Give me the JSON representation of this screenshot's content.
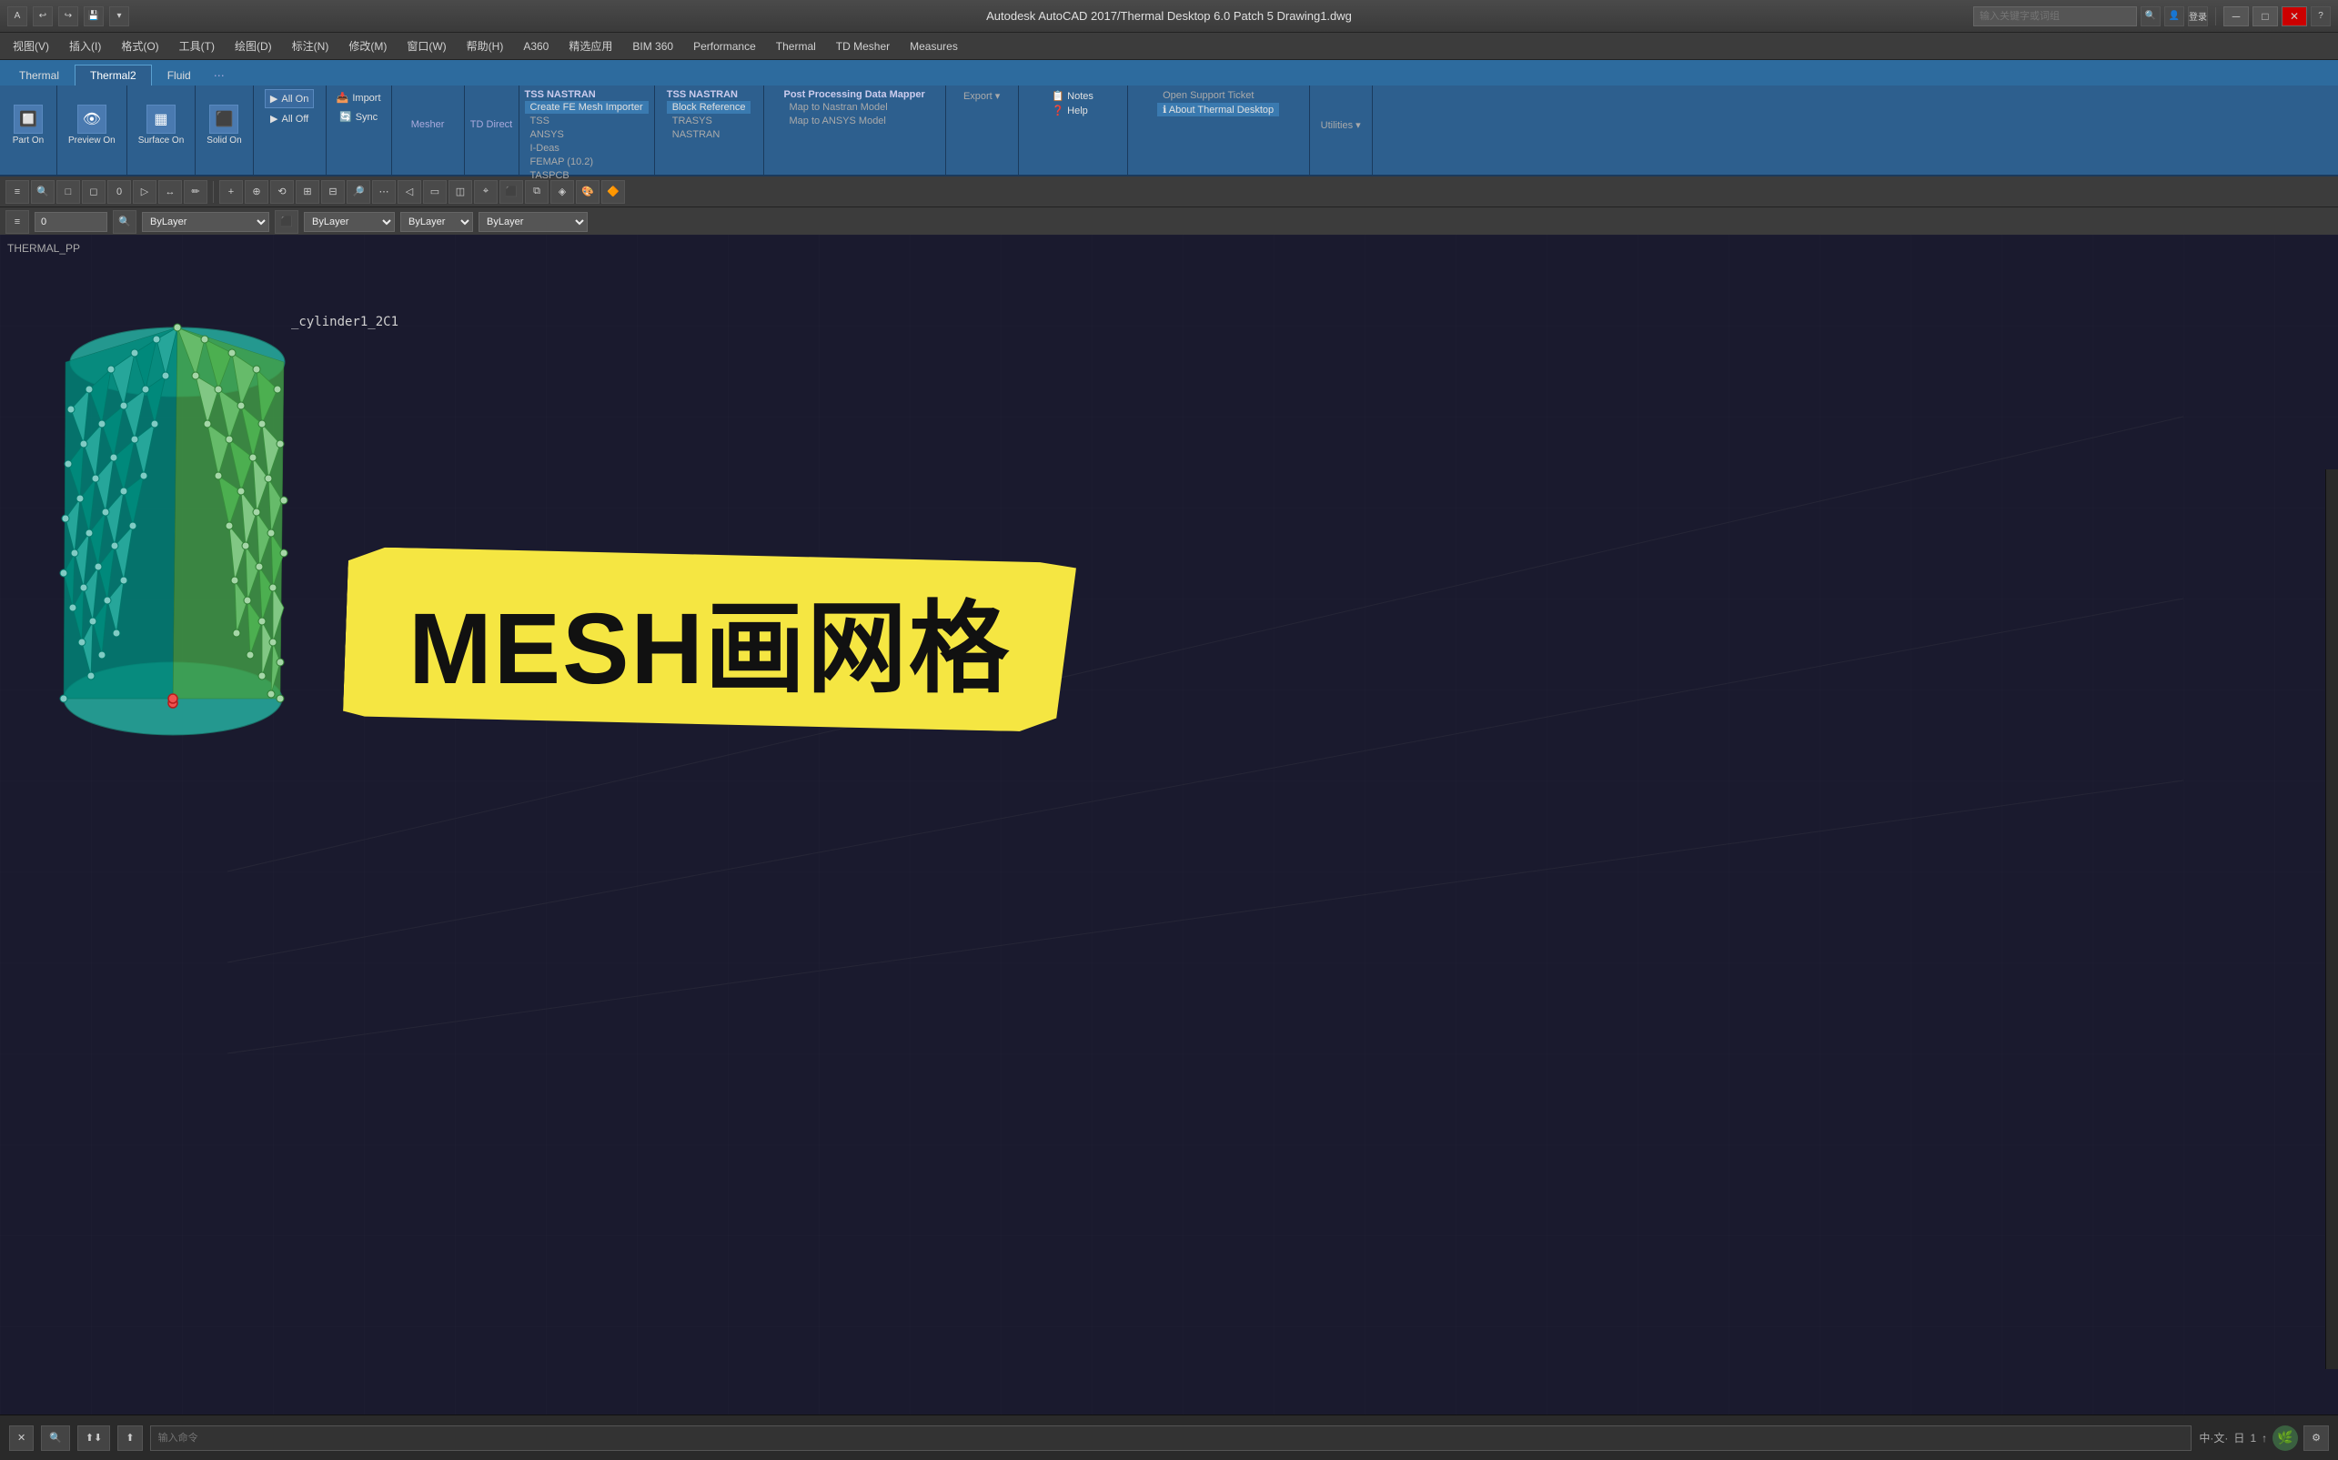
{
  "titlebar": {
    "title": "Autodesk AutoCAD 2017/Thermal Desktop 6.0 Patch 5    Drawing1.dwg",
    "search_placeholder": "输入关键字或词组",
    "login": "登录",
    "close": "✕",
    "minimize": "─",
    "maximize": "□"
  },
  "menubar": {
    "items": [
      {
        "label": "视图(V)"
      },
      {
        "label": "插入(I)"
      },
      {
        "label": "格式(O)"
      },
      {
        "label": "工具(T)"
      },
      {
        "label": "绘图(D)"
      },
      {
        "label": "标注(N)"
      },
      {
        "label": "修改(M)"
      },
      {
        "label": "窗口(W)"
      },
      {
        "label": "帮助(H)"
      },
      {
        "label": "A360"
      },
      {
        "label": "精选应用"
      },
      {
        "label": "BIM 360"
      },
      {
        "label": "Performance"
      },
      {
        "label": "Thermal"
      },
      {
        "label": "TD Mesher"
      },
      {
        "label": "Measures"
      }
    ]
  },
  "ribbon": {
    "tabs": [
      {
        "label": "Thermal"
      },
      {
        "label": "Thermal2",
        "active": true
      },
      {
        "label": "Fluid"
      }
    ],
    "thermal2_groups": [
      {
        "label": "",
        "items": [
          {
            "label": "TSS",
            "sub": "NASTRAN"
          },
          {
            "label": "TSS"
          },
          {
            "label": "I-Deas"
          },
          {
            "label": "NASTRAN"
          }
        ]
      },
      {
        "label": "",
        "items": [
          {
            "label": "ANSYS"
          },
          {
            "label": "FEMAP (10.2)"
          },
          {
            "label": "TASPCB"
          }
        ]
      }
    ]
  },
  "thermal2_menu": {
    "col1_header": "TSS    NASTRAN",
    "col1_items": [
      {
        "label": "Create FE Mesh Importer",
        "highlighted": true
      },
      {
        "label": "TSS"
      },
      {
        "label": "ANSYS"
      },
      {
        "label": "I-Deas"
      },
      {
        "label": "FEMAP (10.2)"
      },
      {
        "label": "TASPCB"
      }
    ],
    "col2_header": "TSS    NASTRAN",
    "col2_items": [
      {
        "label": "Block Reference",
        "highlighted": true
      },
      {
        "label": "TRASYS"
      },
      {
        "label": "NASTRAN"
      }
    ],
    "col3_header": "Post Processing Data Mapper",
    "col3_items": [
      {
        "label": "Map to Nastran Model"
      },
      {
        "label": "Map to ANSYS Model"
      }
    ],
    "col4_header": "Import",
    "col4_items": [
      {
        "label": "Export"
      }
    ]
  },
  "help_menu": {
    "items": [
      {
        "label": "Notes"
      },
      {
        "label": "Help"
      },
      {
        "label": "Open Support Ticket"
      },
      {
        "label": "About Thermal Desktop"
      }
    ]
  },
  "toolbar_ribbon": {
    "groups": [
      {
        "label": "Part On"
      },
      {
        "label": "Preview On"
      },
      {
        "label": "Surface On"
      },
      {
        "label": "Solid On"
      },
      {
        "label": "All On"
      },
      {
        "label": "All Off"
      },
      {
        "label": "Import"
      },
      {
        "label": "Sync"
      },
      {
        "label": "Mesher"
      },
      {
        "label": "TD Direct"
      }
    ]
  },
  "props_bar": {
    "layer_value": "0",
    "layer_select": "ByLayer"
  },
  "viewport": {
    "label": "THERMAL_PP",
    "model_label": "_cylinder1_2C1"
  },
  "mesh_banner": {
    "text": "MESH画网格"
  },
  "statusbar": {
    "close_btn": "✕",
    "search_icon": "🔍",
    "input_placeholder": "输入命令",
    "coord_text": "中文·日·1·↑·⚙"
  }
}
